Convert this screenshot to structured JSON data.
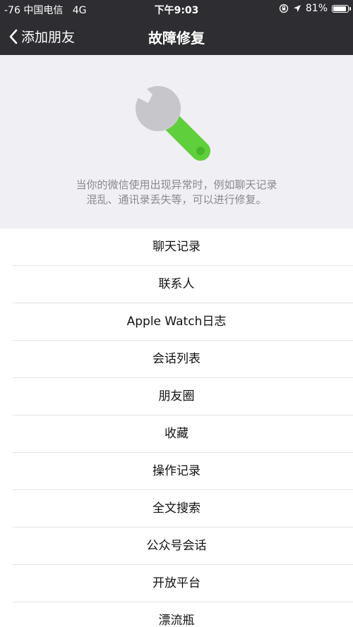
{
  "status": {
    "signal": "-76",
    "carrier": "中国电信",
    "network": "4G",
    "time": "下午9:03",
    "battery_percent": "81%",
    "battery_level": 0.81
  },
  "nav": {
    "back_label": "添加朋友",
    "title": "故障修复"
  },
  "hero": {
    "icon": "wrench-icon",
    "line1": "当你的微信使用出现异常时，例如聊天记录",
    "line2": "混乱、通讯录丢失等，可以进行修复。"
  },
  "list": {
    "items": [
      {
        "label": "聊天记录"
      },
      {
        "label": "联系人"
      },
      {
        "label": "Apple Watch日志"
      },
      {
        "label": "会话列表"
      },
      {
        "label": "朋友圈"
      },
      {
        "label": "收藏"
      },
      {
        "label": "操作记录"
      },
      {
        "label": "全文搜索"
      },
      {
        "label": "公众号会话"
      },
      {
        "label": "开放平台"
      },
      {
        "label": "漂流瓶"
      }
    ]
  },
  "colors": {
    "nav_background": "#2e2e32",
    "page_background": "#efeff4",
    "wrench_head": "#c7c7cb",
    "wrench_handle": "#5fcf3c"
  }
}
